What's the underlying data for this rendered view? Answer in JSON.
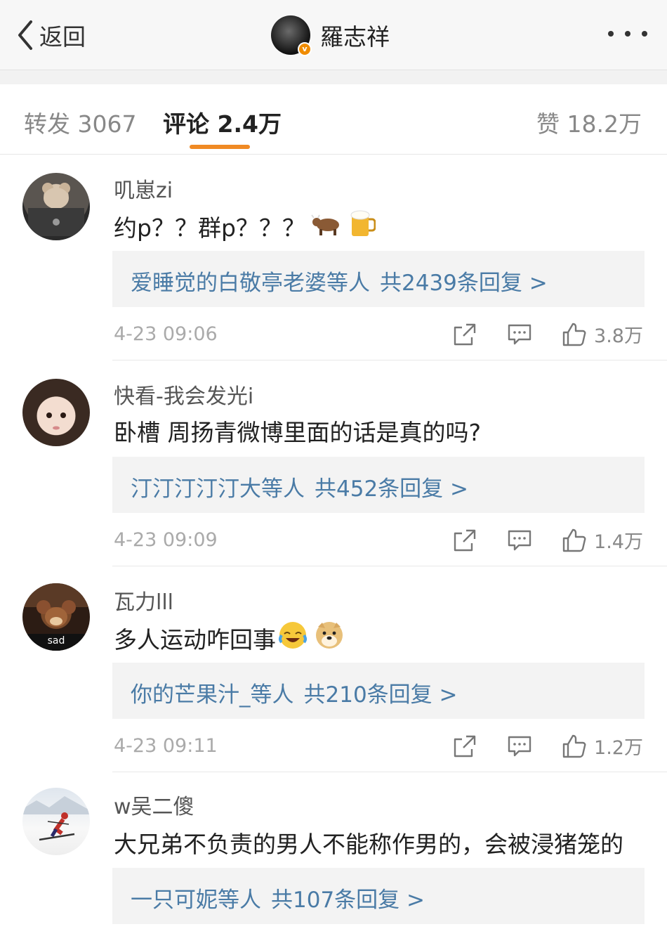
{
  "header": {
    "back_label": "返回",
    "title": "羅志祥",
    "badge": "v"
  },
  "tabs": {
    "repost": "转发 3067",
    "comments": "评论 2.4万",
    "likes": "赞 18.2万"
  },
  "comments": [
    {
      "username": "叽崽zi",
      "text": "约p？？群p？？？",
      "emojis": [
        "cow-emoji",
        "beer-emoji"
      ],
      "reply_users": "爱睡觉的白敬亭老婆等人",
      "reply_count": "共2439条回复 >",
      "time": "4-23 09:06",
      "likes": "3.8万"
    },
    {
      "username": "快看-我会发光i",
      "text": "卧槽 周扬青微博里面的话是真的吗?",
      "emojis": [],
      "reply_users": "汀汀汀汀汀大等人",
      "reply_count": "共452条回复 >",
      "time": "4-23 09:09",
      "likes": "1.4万"
    },
    {
      "username": "瓦力lll",
      "text": "多人运动咋回事",
      "emojis": [
        "laugh-cry-emoji",
        "doge-emoji"
      ],
      "reply_users": "你的芒果汁_等人",
      "reply_count": "共210条回复 >",
      "time": "4-23 09:11",
      "likes": "1.2万"
    },
    {
      "username": "w吴二傻",
      "text": "大兄弟不负责的男人不能称作男的，会被浸猪笼的",
      "emojis": [],
      "reply_users": "一只可妮等人",
      "reply_count": "共107条回复 >",
      "time": "",
      "likes": ""
    }
  ],
  "avatars": {
    "c1": "bear-avatar",
    "c2": "girl-avatar",
    "c3": "mouse-avatar",
    "c3_caption": "sad",
    "c4": "skier-avatar"
  },
  "colors": {
    "accent": "#f08a24",
    "reply_link": "#4a7ba6"
  }
}
